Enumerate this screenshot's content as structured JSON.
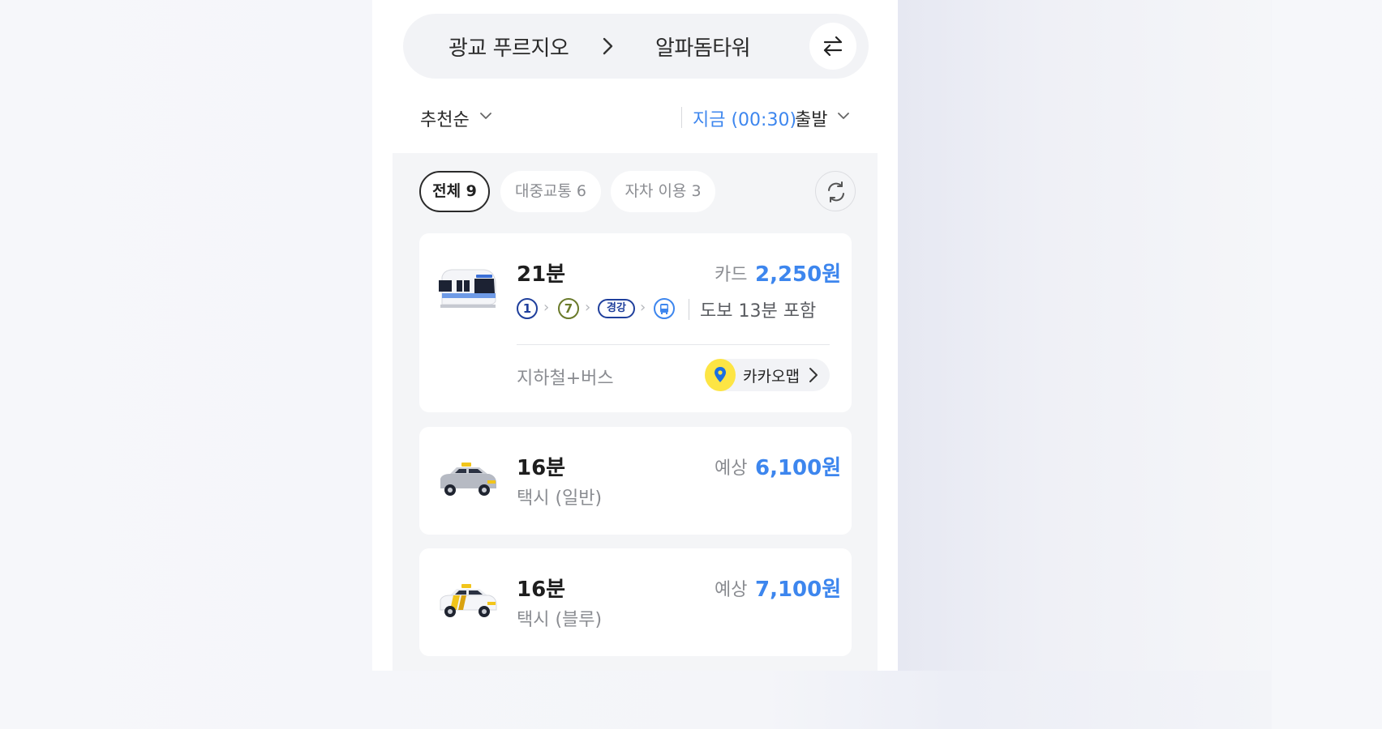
{
  "route": {
    "origin": "광교 푸르지오",
    "destination": "알파돔타워"
  },
  "options": {
    "sort_label": "추천순",
    "depart_time": "지금 (00:30)",
    "depart_label": "출발"
  },
  "filters": [
    {
      "label": "전체 9",
      "active": true
    },
    {
      "label": "대중교통 6",
      "active": false
    },
    {
      "label": "자차 이용 3",
      "active": false
    }
  ],
  "results": [
    {
      "vehicle_icon": "subway-bus-icon",
      "duration": "21분",
      "price_prefix": "카드",
      "price": "2,250원",
      "steps": [
        "1",
        "7",
        "경강",
        "bus"
      ],
      "walk_note": "도보 13분 포함",
      "mode": "지하철+버스",
      "map_link": "카카오맵"
    },
    {
      "vehicle_icon": "taxi-regular-icon",
      "duration": "16분",
      "price_prefix": "예상",
      "price": "6,100원",
      "mode": "택시 (일반)"
    },
    {
      "vehicle_icon": "taxi-blue-icon",
      "duration": "16분",
      "price_prefix": "예상",
      "price": "7,100원",
      "mode": "택시 (블루)"
    }
  ],
  "colors": {
    "accent": "#3d86ee",
    "line1": "#1f3f9c",
    "line7": "#6a7a2a",
    "gyeonggang": "#1f3f9c",
    "bus": "#3d86ee",
    "kakao_yellow": "#fde544"
  }
}
